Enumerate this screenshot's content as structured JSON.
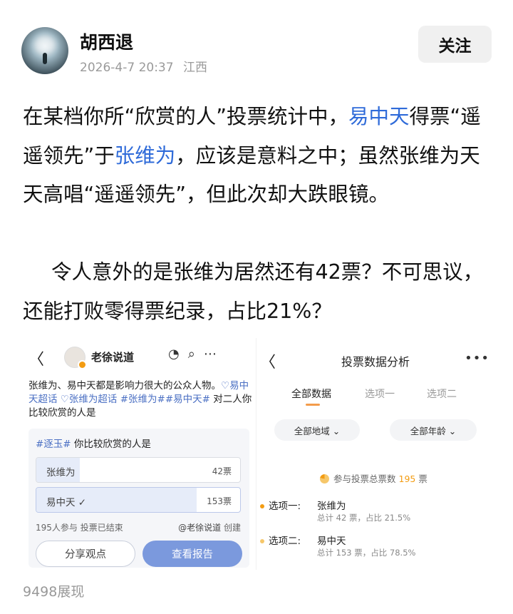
{
  "header": {
    "author": "胡西退",
    "date": "2026-4-7 20:37",
    "location": "江西",
    "follow_label": "关注"
  },
  "post": {
    "p1": [
      {
        "text": "在某档你所“欣赏的人”投票统计中，",
        "link": false
      },
      {
        "text": "易中天",
        "link": true
      },
      {
        "text": "得票“遥遥领先”于",
        "link": false
      },
      {
        "text": "张维为",
        "link": true
      },
      {
        "text": "，应该是意料之中；虽然张维为天天高唱“遥遥领先”，但此次却大跌眼镜。",
        "link": false
      }
    ],
    "p2": "令人意外的是张维为居然还有42票？不可思议，还能打败零得票纪录，占比21%？"
  },
  "colors": {
    "link": "#2f6bd9",
    "accent_orange": "#f39c12",
    "report_button": "#7b99dd"
  },
  "left_image": {
    "back_icon": "back-arrow-icon",
    "account_name": "老徐说道",
    "icons": [
      "listen-icon",
      "search-icon",
      "more-icon"
    ],
    "text_plain1": "张维为、易中天都是影响力很大的公众人物。",
    "tag1": "♡易中天超话",
    "tag2": "♡张维为超话",
    "tag3": "#张维为##易中天#",
    "text_plain2": " 对二人你比较欣赏的人是",
    "question_tag": "#逐玉#",
    "question": " 你比较欣赏的人是",
    "options": [
      {
        "label": "张维为",
        "count": "42票",
        "fraction": 0.215,
        "checked": false
      },
      {
        "label": "易中天 ✓",
        "count": "153票",
        "fraction": 0.785,
        "checked": true
      }
    ],
    "participants": "195人参与",
    "status": "投票已结束",
    "creator": "@老徐说道",
    "creator_suffix": " 创建",
    "share_label": "分享观点",
    "report_label": "查看报告"
  },
  "right_image": {
    "title": "投票数据分析",
    "tabs": [
      "全部数据",
      "选项一",
      "选项二"
    ],
    "filters": [
      "全部地域 ⌄",
      "全部年龄 ⌄"
    ],
    "total_prefix": "参与投票总票数",
    "total_num": "195",
    "total_suffix": " 票",
    "options": [
      {
        "label": "选项一:",
        "name": "张维为",
        "stat": "总计 42 票，占比 21.5%",
        "dot_color": "#f39c12"
      },
      {
        "label": "选项二:",
        "name": "易中天",
        "stat": "总计 153 票，占比 78.5%",
        "dot_color": "#f6c76a"
      }
    ]
  },
  "footer": {
    "views": "9498展现"
  }
}
